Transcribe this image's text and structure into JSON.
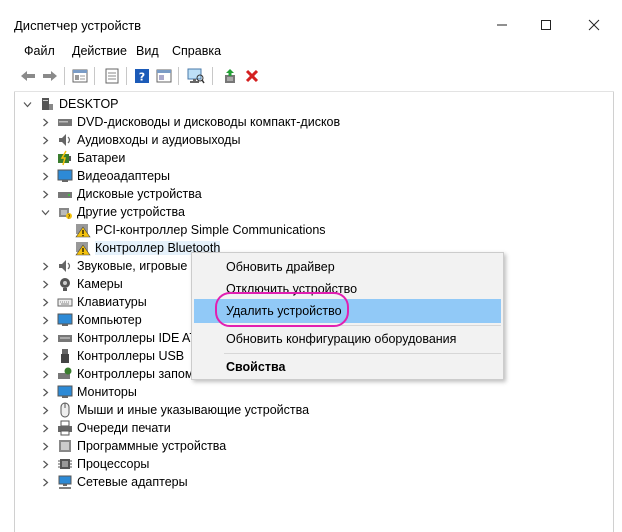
{
  "window": {
    "title": "Диспетчер устройств"
  },
  "menu": [
    "Файл",
    "Действие",
    "Вид",
    "Справка"
  ],
  "tree": {
    "root": "DESKTOP",
    "categories": [
      "DVD-дисководы и дисководы компакт-дисков",
      "Аудиовходы и аудиовыходы",
      "Батареи",
      "Видеоадаптеры",
      "Дисковые устройства",
      "Другие устройства",
      "Звуковые, игровые и",
      "Камеры",
      "Клавиатуры",
      "Компьютер",
      "Контроллеры IDE ATA",
      "Контроллеры USB",
      "Контроллеры запом",
      "Мониторы",
      "Мыши и иные указывающие устройства",
      "Очереди печати",
      "Программные устройства",
      "Процессоры",
      "Сетевые адаптеры"
    ],
    "other_children": [
      "PCI-контроллер Simple Communications",
      "Контроллер Bluetooth"
    ]
  },
  "context_menu": {
    "items": [
      "Обновить драйвер",
      "Отключить устройство",
      "Удалить устройство",
      "Обновить конфигурацию оборудования",
      "Свойства"
    ],
    "highlighted_index": 2
  },
  "colors": {
    "highlight": "#91c9f7",
    "annotation": "#e11fb2",
    "delete_icon": "#d42121"
  }
}
